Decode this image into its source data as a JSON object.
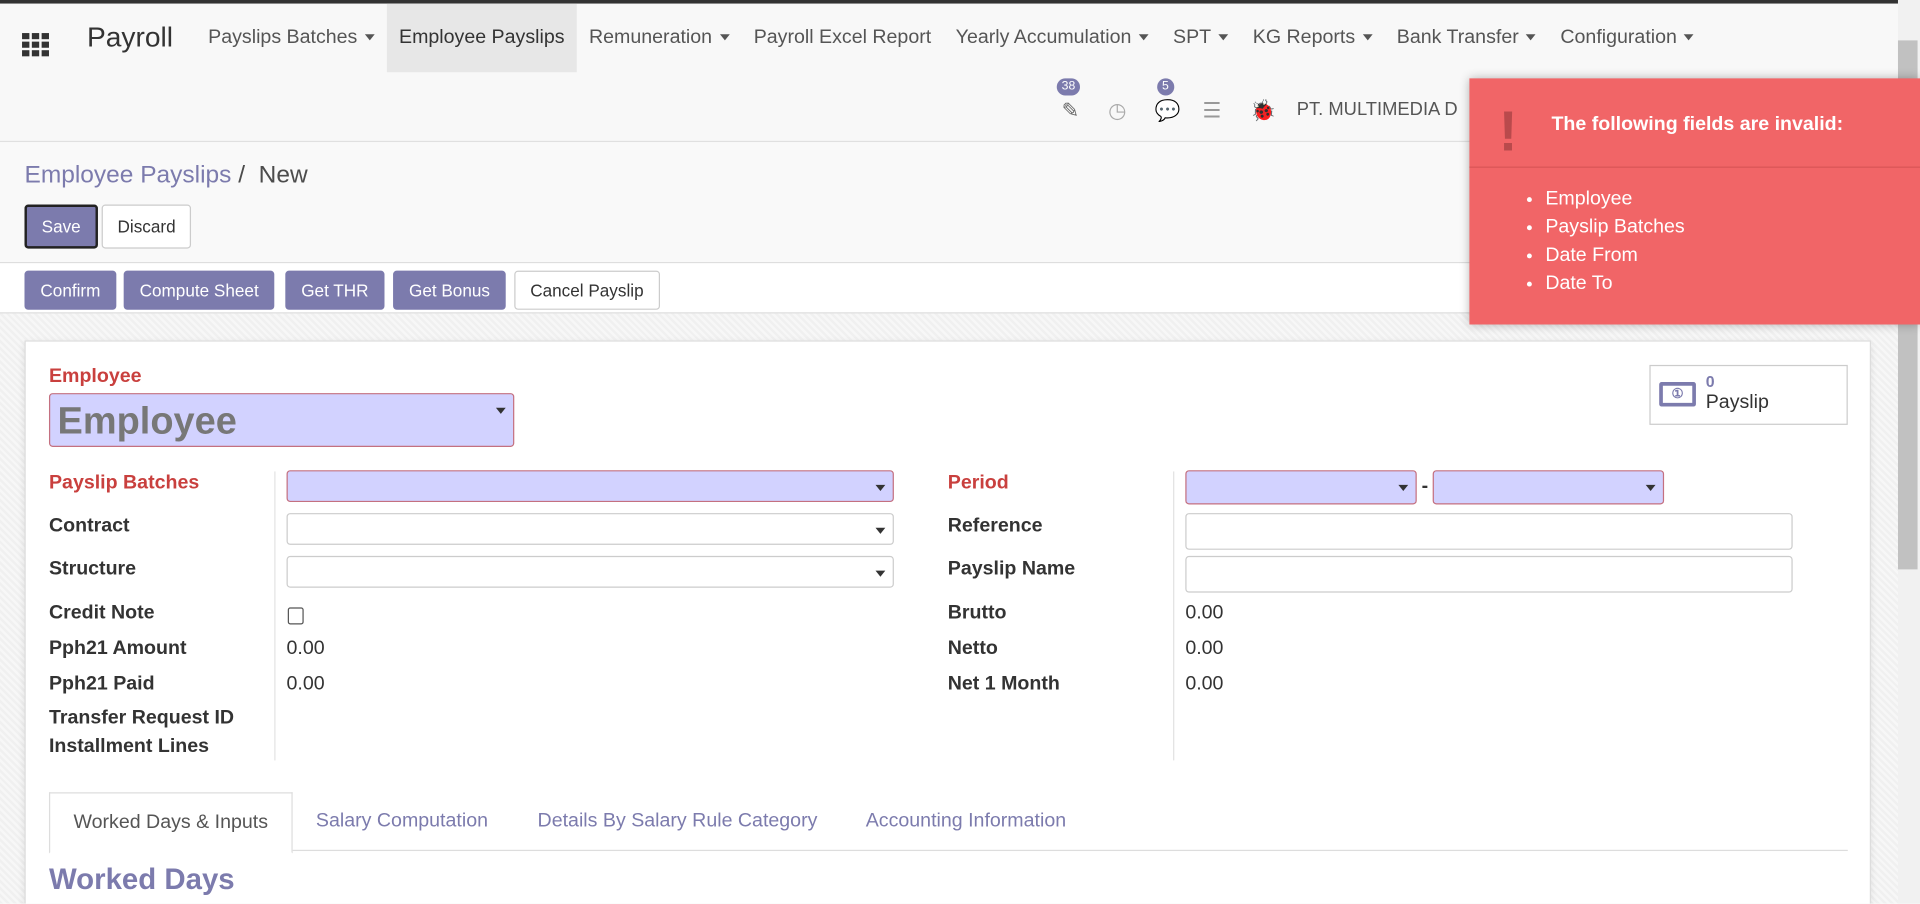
{
  "nav": {
    "app": "Payroll",
    "menu": [
      {
        "label": "Payslips Batches",
        "dropdown": true
      },
      {
        "label": "Employee Payslips",
        "dropdown": false,
        "active": true
      },
      {
        "label": "Remuneration",
        "dropdown": true
      },
      {
        "label": "Payroll Excel Report",
        "dropdown": false
      },
      {
        "label": "Yearly Accumulation",
        "dropdown": true
      },
      {
        "label": "SPT",
        "dropdown": true
      },
      {
        "label": "KG Reports",
        "dropdown": true
      },
      {
        "label": "Bank Transfer",
        "dropdown": true
      },
      {
        "label": "Configuration",
        "dropdown": true
      }
    ],
    "activity_count": "38",
    "message_count": "5",
    "company": "PT. MULTIMEDIA D"
  },
  "breadcrumb": {
    "parent": "Employee Payslips",
    "separator": "/",
    "current": "New"
  },
  "buttons": {
    "save": "Save",
    "discard": "Discard"
  },
  "status_buttons": [
    "Confirm",
    "Compute Sheet",
    "Get THR",
    "Get Bonus",
    "Cancel Payslip"
  ],
  "form": {
    "employee_label": "Employee",
    "employee_placeholder": "Employee",
    "smart_button": {
      "count": "0",
      "label": "Payslip"
    },
    "left": {
      "payslip_batches": "Payslip Batches",
      "contract": "Contract",
      "structure": "Structure",
      "credit_note": "Credit Note",
      "pph21_amount": "Pph21 Amount",
      "pph21_amount_value": "0.00",
      "pph21_paid": "Pph21 Paid",
      "pph21_paid_value": "0.00",
      "transfer_request": "Transfer Request ID",
      "installment_lines": "Installment Lines"
    },
    "right": {
      "period": "Period",
      "period_sep": "-",
      "reference": "Reference",
      "payslip_name": "Payslip Name",
      "brutto": "Brutto",
      "brutto_value": "0.00",
      "netto": "Netto",
      "netto_value": "0.00",
      "net_1_month": "Net 1 Month",
      "net_1_month_value": "0.00"
    }
  },
  "tabs": [
    "Worked Days & Inputs",
    "Salary Computation",
    "Details By Salary Rule Category",
    "Accounting Information"
  ],
  "section_title": "Worked Days",
  "notification": {
    "title": "The following fields are invalid:",
    "items": [
      "Employee",
      "Payslip Batches",
      "Date From",
      "Date To"
    ],
    "color": "#f16567"
  },
  "colors": {
    "primary": "#7c7bad",
    "required_bg": "#d2d2ff",
    "required_label": "#c9403e"
  }
}
